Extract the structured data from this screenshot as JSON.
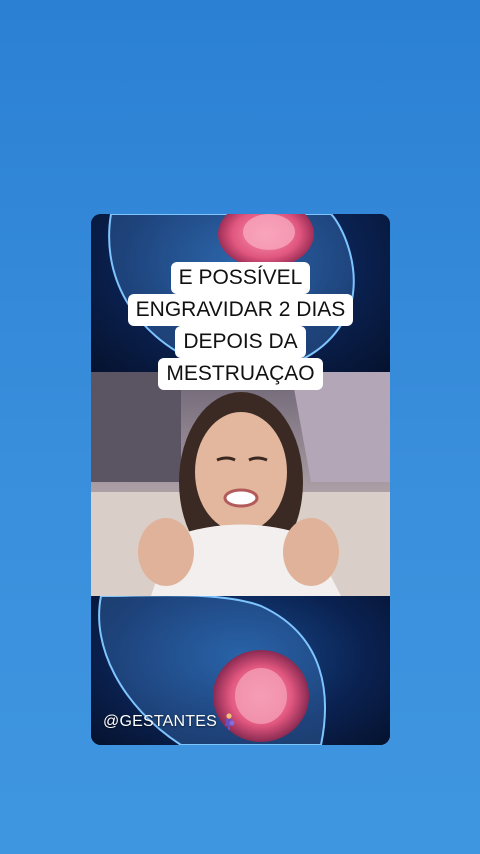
{
  "story": {
    "caption_lines": [
      "E POSSÍVEL",
      "ENGRAVIDAR 2 DIAS",
      "DEPOIS DA",
      "MESTRUAÇAO"
    ],
    "handle": "@GESTANTES",
    "handle_icon": "pregnant-emoji-icon"
  },
  "colors": {
    "background": "#2f86d8",
    "caption_bg": "#ffffff",
    "caption_text": "#111111"
  }
}
